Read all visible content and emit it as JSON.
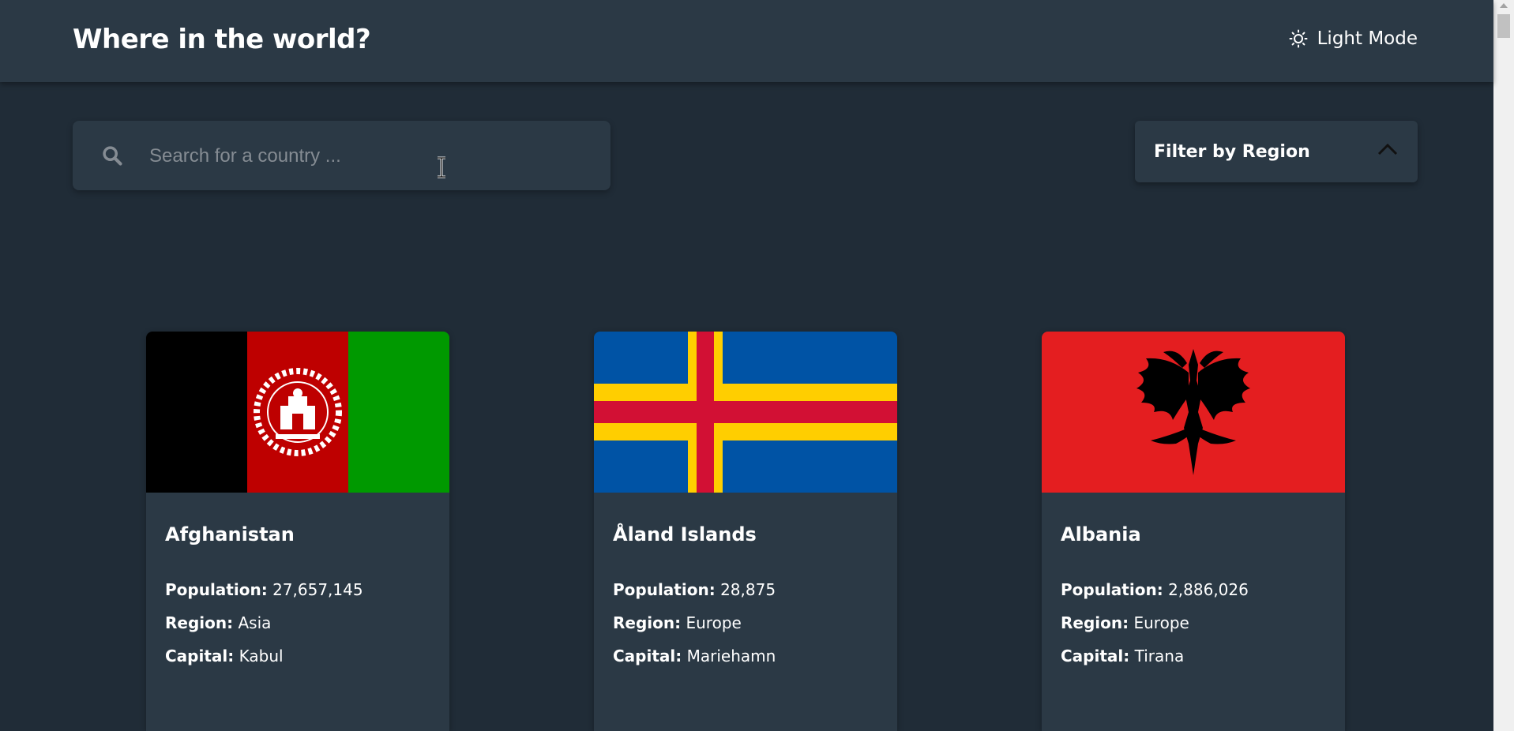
{
  "header": {
    "title": "Where in the world?",
    "theme_toggle_label": "Light Mode",
    "theme_icon": "sun-icon"
  },
  "search": {
    "placeholder": "Search for a country ...",
    "value": "",
    "icon": "search-icon"
  },
  "filter": {
    "label": "Filter by Region",
    "icon": "chevron-up-icon",
    "expanded": true
  },
  "labels": {
    "population": "Population:",
    "region": "Region:",
    "capital": "Capital:"
  },
  "countries": [
    {
      "name": "Afghanistan",
      "population": "27,657,145",
      "region": "Asia",
      "capital": "Kabul"
    },
    {
      "name": "Åland Islands",
      "population": "28,875",
      "region": "Europe",
      "capital": "Mariehamn"
    },
    {
      "name": "Albania",
      "population": "2,886,026",
      "region": "Europe",
      "capital": "Tirana"
    }
  ],
  "colors": {
    "background": "#202c37",
    "elements": "#2b3945",
    "text": "#ffffff"
  }
}
